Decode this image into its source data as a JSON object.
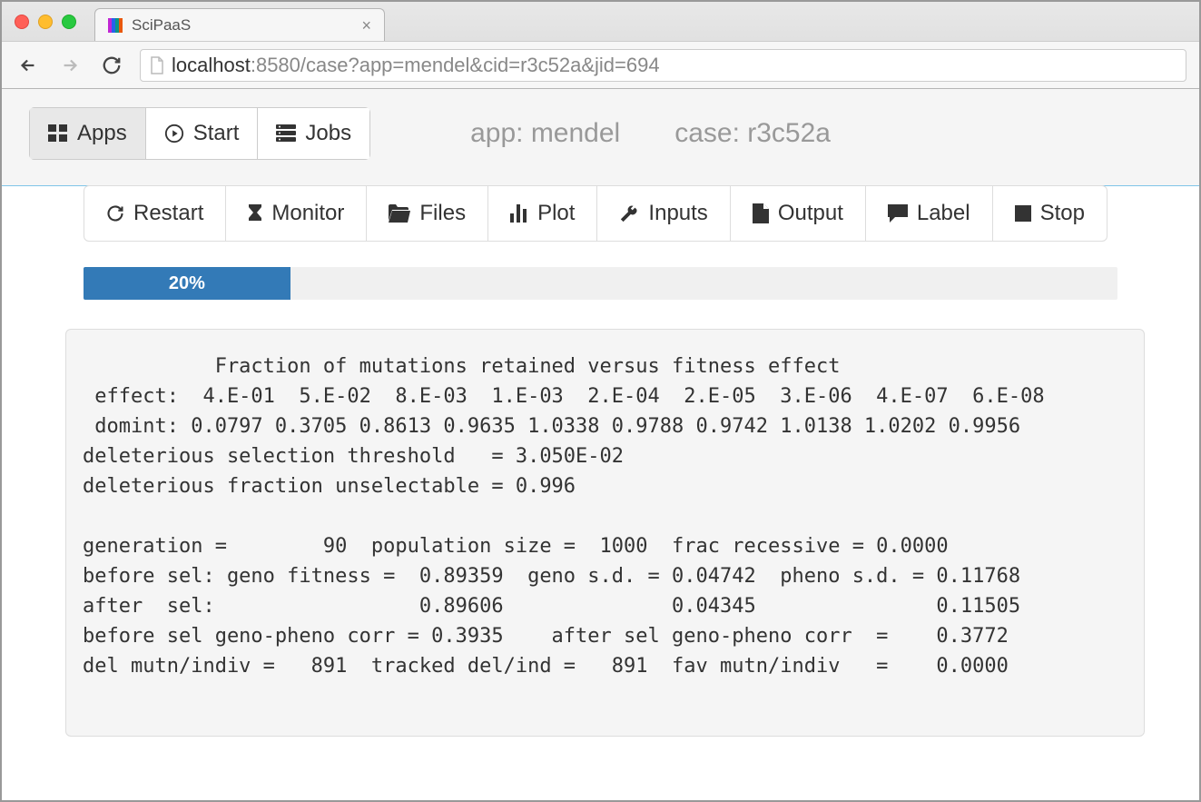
{
  "browser": {
    "tab_title": "SciPaaS",
    "url_host": "localhost",
    "url_path": ":8580/case?app=mendel&cid=r3c52a&jid=694"
  },
  "header": {
    "nav": {
      "apps": "Apps",
      "start": "Start",
      "jobs": "Jobs"
    },
    "app_label": "app: mendel",
    "case_label": "case: r3c52a"
  },
  "toolbar": {
    "restart": "Restart",
    "monitor": "Monitor",
    "files": "Files",
    "plot": "Plot",
    "inputs": "Inputs",
    "output": "Output",
    "label": "Label",
    "stop": "Stop"
  },
  "progress": {
    "percent": 20,
    "text": "20%"
  },
  "console": {
    "text": "           Fraction of mutations retained versus fitness effect\n effect:  4.E-01  5.E-02  8.E-03  1.E-03  2.E-04  2.E-05  3.E-06  4.E-07  6.E-08\n domint: 0.0797 0.3705 0.8613 0.9635 1.0338 0.9788 0.9742 1.0138 1.0202 0.9956\ndeleterious selection threshold   = 3.050E-02\ndeleterious fraction unselectable = 0.996\n\ngeneration =        90  population size =  1000  frac recessive = 0.0000\nbefore sel: geno fitness =  0.89359  geno s.d. = 0.04742  pheno s.d. = 0.11768\nafter  sel:                 0.89606              0.04345               0.11505\nbefore sel geno-pheno corr = 0.3935    after sel geno-pheno corr  =    0.3772\ndel mutn/indiv =   891  tracked del/ind =   891  fav mutn/indiv   =    0.0000"
  }
}
